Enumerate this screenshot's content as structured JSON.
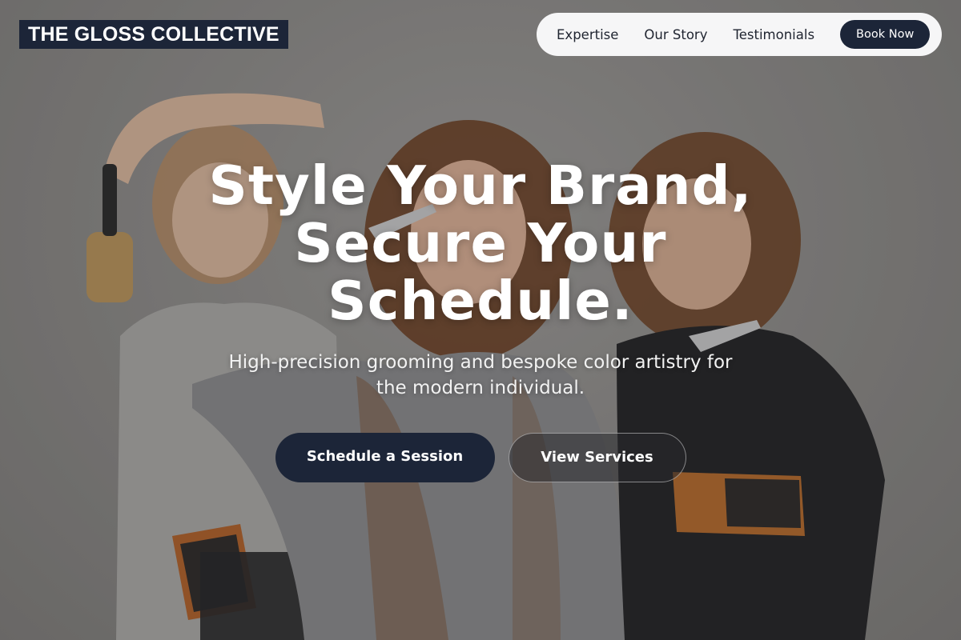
{
  "brand": {
    "logo_text": "THE GLOSS COLLECTIVE"
  },
  "nav": {
    "links": [
      "Expertise",
      "Our Story",
      "Testimonials"
    ],
    "book_label": "Book Now"
  },
  "hero": {
    "headline_lines": [
      "Style Your Brand,",
      "Secure Your",
      "Schedule."
    ],
    "subtitle_lines": [
      "High-precision grooming and bespoke color artistry for",
      "the modern individual."
    ],
    "primary_cta": "Schedule a Session",
    "secondary_cta": "View Services",
    "image": "hero-photo-three-stylists-with-brushes-and-scissors"
  },
  "colors": {
    "brand_navy": "#1c2538",
    "nav_bg": "#f6f6f7",
    "text_light": "#ffffff"
  }
}
